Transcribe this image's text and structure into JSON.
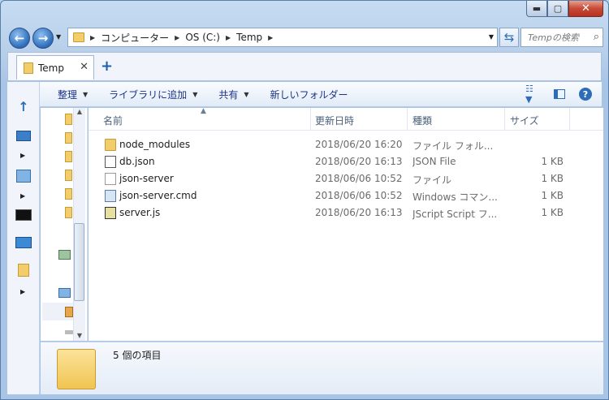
{
  "window": {
    "caption_buttons": {
      "minimize": "▬",
      "maximize": "▢",
      "close": "✕"
    }
  },
  "address": {
    "crumbs": [
      "コンピューター",
      "OS (C:)",
      "Temp"
    ],
    "search_placeholder": "Tempの検索"
  },
  "tabs": [
    {
      "label": "Temp"
    }
  ],
  "toolbar": {
    "items": [
      "整理",
      "ライブラリに追加",
      "共有",
      "新しいフォルダー"
    ]
  },
  "columns": [
    "名前",
    "更新日時",
    "種類",
    "サイズ"
  ],
  "files": [
    {
      "name": "node_modules",
      "date": "2018/06/20 16:20",
      "type": "ファイル フォル...",
      "size": "",
      "icon": "folder-icon"
    },
    {
      "name": "db.json",
      "date": "2018/06/20 16:13",
      "type": "JSON File",
      "size": "1 KB",
      "icon": "json-file-icon"
    },
    {
      "name": "json-server",
      "date": "2018/06/06 10:52",
      "type": "ファイル",
      "size": "1 KB",
      "icon": "file-icon"
    },
    {
      "name": "json-server.cmd",
      "date": "2018/06/06 10:52",
      "type": "Windows コマン...",
      "size": "1 KB",
      "icon": "cmd-file-icon"
    },
    {
      "name": "server.js",
      "date": "2018/06/20 16:13",
      "type": "JScript Script フ...",
      "size": "1 KB",
      "icon": "js-file-icon"
    }
  ],
  "details": {
    "count": "5 個の項目"
  },
  "colors": {
    "accent": "#2d6db8",
    "folder": "#f2cd6a",
    "toolbar_text": "#1e3287"
  }
}
